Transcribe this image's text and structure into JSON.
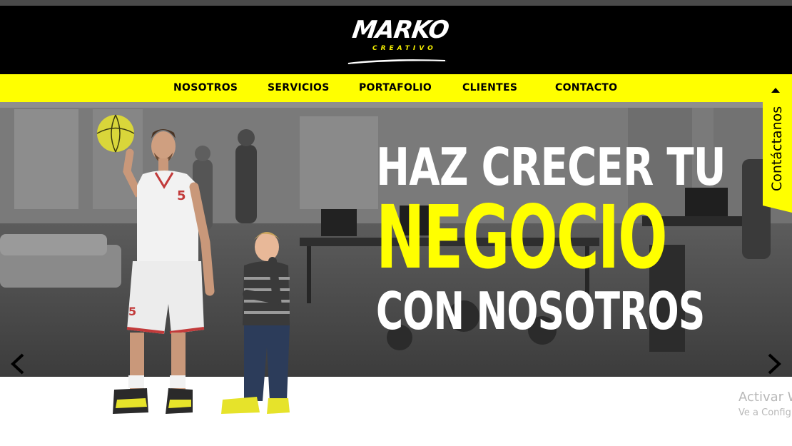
{
  "brand": {
    "logo_text": "MARKO",
    "logo_subtext": "CREATIVO"
  },
  "nav": {
    "items": [
      {
        "label": "NOSOTROS"
      },
      {
        "label": "SERVICIOS"
      },
      {
        "label": "PORTAFOLIO"
      },
      {
        "label": "CLIENTES"
      },
      {
        "label": "CONTACTO"
      }
    ]
  },
  "hero": {
    "line1": "HAZ CRECER TU",
    "line2": "NEGOCIO",
    "line3": "CON NOSOTROS",
    "prev_icon": "chevron-left-icon",
    "next_icon": "chevron-right-icon"
  },
  "side_tab": {
    "label": "Contáctanos",
    "icon": "caret-up-icon"
  },
  "watermark": {
    "line1": "Activar W",
    "line2": "Ve a Config"
  },
  "colors": {
    "accent": "#ffff00",
    "header_bg": "#000000",
    "text_light": "#ffffff"
  }
}
